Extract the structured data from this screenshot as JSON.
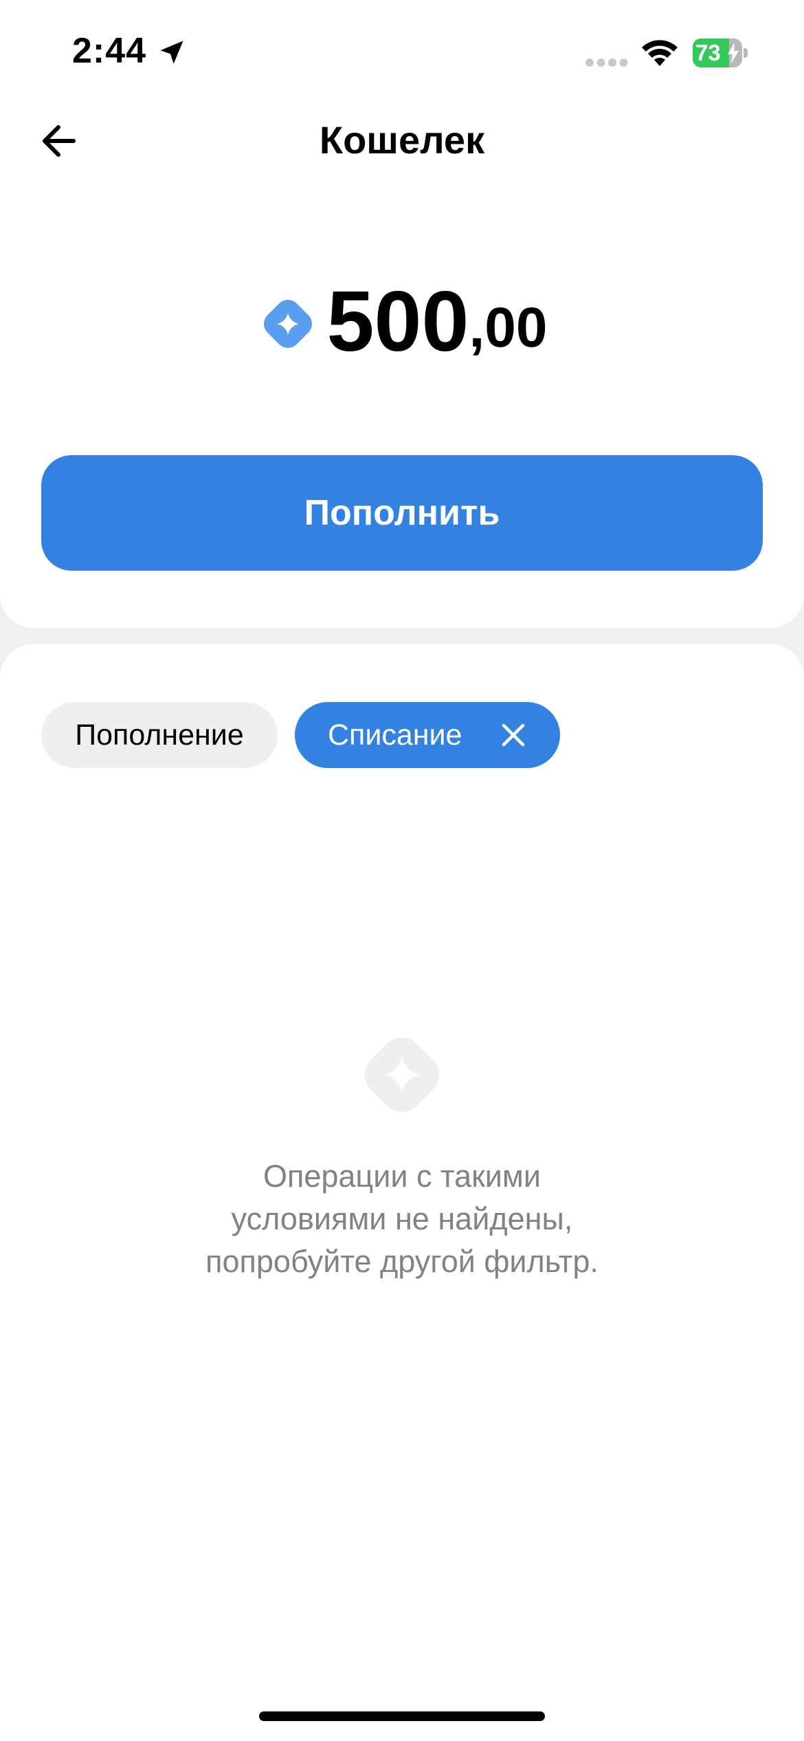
{
  "status_bar": {
    "time": "2:44",
    "battery": "73",
    "battery_level": 0.73
  },
  "header": {
    "title": "Кошелек"
  },
  "balance": {
    "integer": "500",
    "fraction": ",00"
  },
  "actions": {
    "topup_label": "Пополнить"
  },
  "filters": {
    "income_label": "Пополнение",
    "expense_label": "Списание",
    "active": "Списание"
  },
  "empty_state": {
    "lines": [
      "Операции с такими",
      "условиями не найдены,",
      "попробуйте другой фильтр."
    ]
  },
  "colors": {
    "accent": "#3381e0",
    "balance_icon": "#5b9ef0",
    "empty_icon": "#efeff0",
    "muted_text": "#818187"
  },
  "icons": {
    "back": "arrow-left-icon",
    "balance": "wallet-coin-icon",
    "chip_close": "close-icon",
    "empty": "empty-coin-icon"
  }
}
